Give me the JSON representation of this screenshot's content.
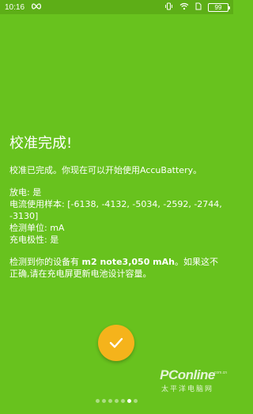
{
  "status_bar": {
    "time": "10:16",
    "battery_level": "99",
    "icons": [
      "infinity-icon",
      "vibrate-icon",
      "wifi-icon",
      "sim-icon",
      "battery-icon"
    ]
  },
  "calibration": {
    "title": "校准完成!",
    "intro": "校准已完成。你现在可以开始使用AccuBattery。",
    "discharge": "放电: 是",
    "current_samples_label": "电流使用样本:",
    "current_samples": "[-6138, -4132, -5034, -2592, -2744, -3130]",
    "unit": "检测单位: mA",
    "polarity": "充电极性: 是",
    "detected_prefix": "检测到你的设备有",
    "detected_capacity": "m2 note3,050 mAh",
    "detected_suffix": "。如果这不正确,请在充电屏更新电池设计容量。"
  },
  "pager": {
    "dot_count": 7,
    "active_index": 5
  },
  "confirm_button": {
    "icon": "check-icon"
  },
  "watermark": {
    "brand": "PConline",
    "domain": ".com.cn",
    "subtitle": "太平洋电脑网"
  },
  "colors": {
    "background": "#68c21e",
    "status_bar": "#5dae17",
    "fab": "#f5b31b",
    "text": "#ffffff"
  }
}
